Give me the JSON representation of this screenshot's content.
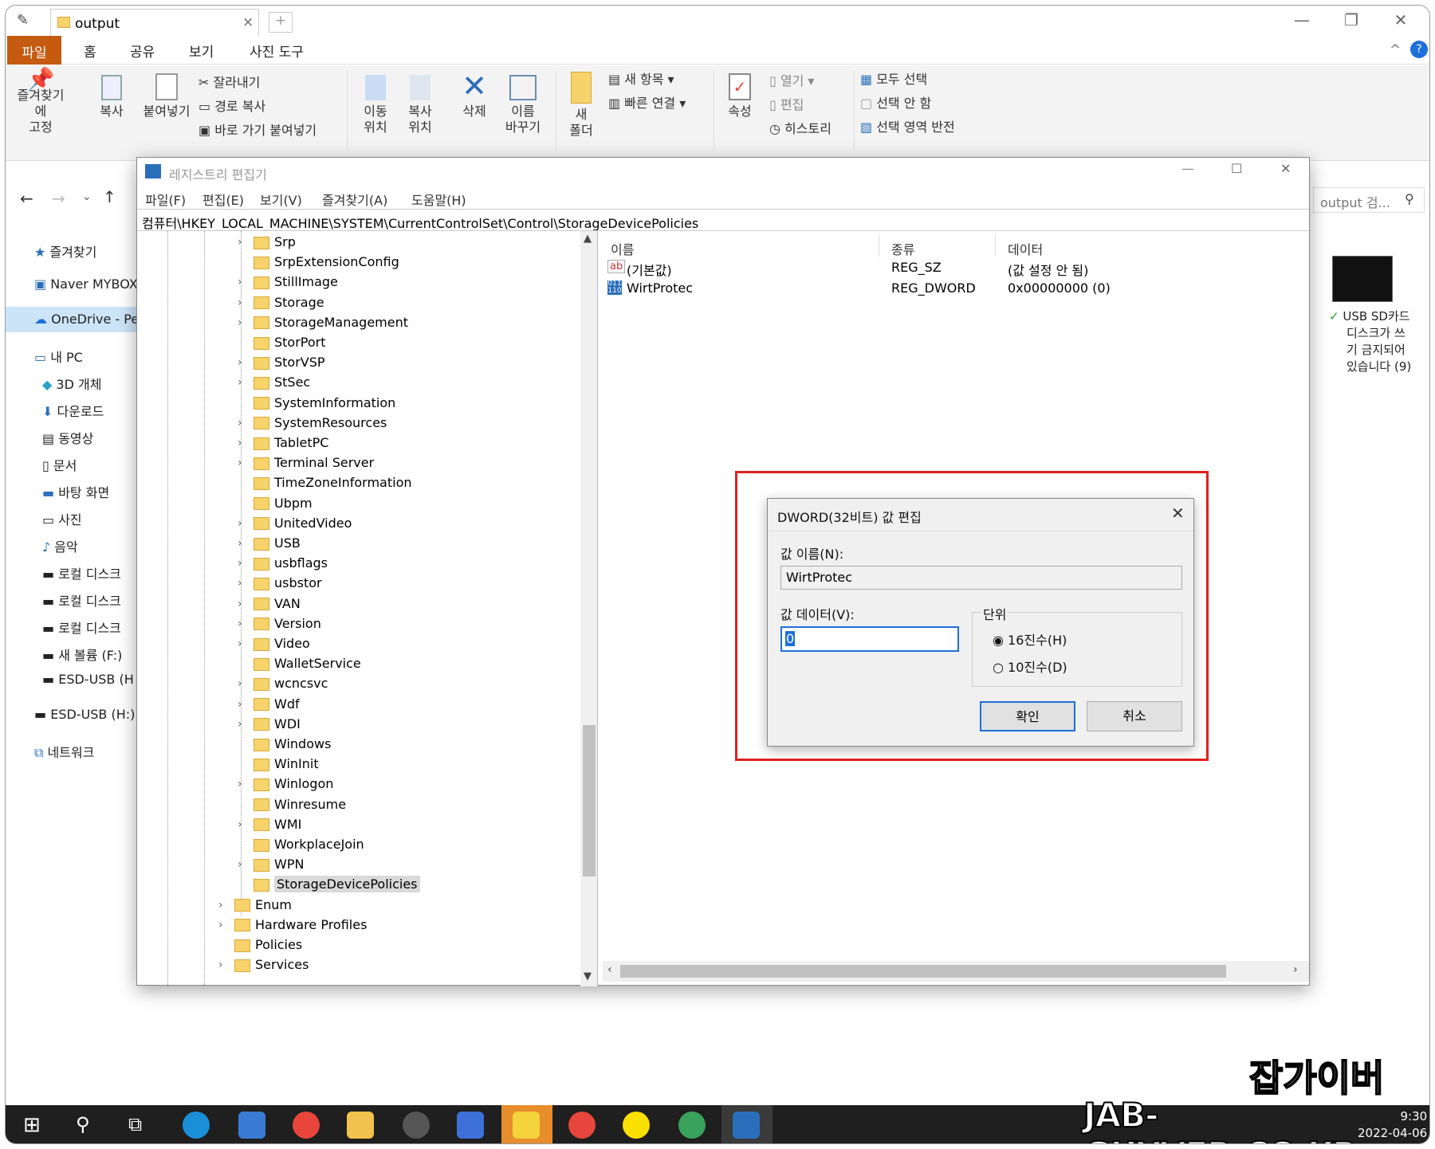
{
  "explorer": {
    "tab_title": "output",
    "ribbon_tabs": [
      "파일",
      "홈",
      "공유",
      "보기",
      "사진 도구"
    ],
    "ribbon": {
      "pin": "즐겨찾기에",
      "pin2": "고정",
      "copy": "복사",
      "paste": "붙여넣기",
      "cut": "잘라내기",
      "copy_path": "경로 복사",
      "paste_shortcut": "바로 가기 붙여넣기",
      "move": "이동",
      "move2": "위치",
      "copyto": "복사",
      "copyto2": "위치",
      "delete": "삭제",
      "rename": "이름",
      "rename2": "바꾸기",
      "newfolder": "새",
      "newfolder2": "폴더",
      "new_item": "새 항목",
      "easy_access": "빠른 연결",
      "properties": "속성",
      "open": "열기",
      "edit": "편집",
      "history": "히스토리",
      "select_all": "모두 선택",
      "select_none": "선택 안 함",
      "invert": "선택 영역 반전"
    },
    "search_placeholder": "output 검...",
    "nav": [
      "즐겨찾기",
      "Naver MYBOX",
      "OneDrive - Pe",
      "내 PC",
      "3D 개체",
      "다운로드",
      "동영상",
      "문서",
      "바탕 화면",
      "사진",
      "음악",
      "로컬 디스크",
      "로컬 디스크",
      "로컬 디스크",
      "새 볼륨 (F:)",
      "ESD-USB (H",
      "ESD-USB (H:)",
      "네트워크"
    ],
    "thumb_caption": [
      "USB SD카드",
      "디스크가 쓰",
      "기 금지되어",
      "있습니다 (9)"
    ]
  },
  "regedit": {
    "title": "레지스트리 편집기",
    "menu": [
      "파일(F)",
      "편집(E)",
      "보기(V)",
      "즐겨찾기(A)",
      "도움말(H)"
    ],
    "address": "컴퓨터\\HKEY_LOCAL_MACHINE\\SYSTEM\\CurrentControlSet\\Control\\StorageDevicePolicies",
    "tree": [
      "Srp",
      "SrpExtensionConfig",
      "StillImage",
      "Storage",
      "StorageManagement",
      "StorPort",
      "StorVSP",
      "StSec",
      "SystemInformation",
      "SystemResources",
      "TabletPC",
      "Terminal Server",
      "TimeZoneInformation",
      "Ubpm",
      "UnitedVideo",
      "USB",
      "usbflags",
      "usbstor",
      "VAN",
      "Version",
      "Video",
      "WalletService",
      "wcncsvc",
      "Wdf",
      "WDI",
      "Windows",
      "WinInit",
      "Winlogon",
      "Winresume",
      "WMI",
      "WorkplaceJoin",
      "WPN",
      "StorageDevicePolicies",
      "Enum",
      "Hardware Profiles",
      "Policies",
      "Services"
    ],
    "columns": [
      "이름",
      "종류",
      "데이터"
    ],
    "values": [
      {
        "name": "(기본값)",
        "type": "REG_SZ",
        "data": "(값 설정 안 됨)"
      },
      {
        "name": "WirtProtec",
        "type": "REG_DWORD",
        "data": "0x00000000 (0)"
      }
    ]
  },
  "dialog": {
    "title": "DWORD(32비트) 값 편집",
    "name_label": "값 이름(N):",
    "name_value": "WirtProtec",
    "data_label": "값 데이터(V):",
    "data_value": "0",
    "base_label": "단위",
    "hex": "16진수(H)",
    "dec": "10진수(D)",
    "ok": "확인",
    "cancel": "취소"
  },
  "taskbar": {
    "time": "9:30",
    "date": "2022-04-06"
  },
  "watermark": {
    "ko": "잡가이버",
    "en": "JAB-GUYVER.CO.KR"
  }
}
